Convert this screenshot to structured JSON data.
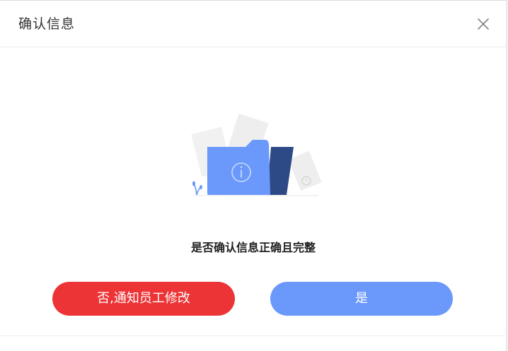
{
  "dialog": {
    "title": "确认信息",
    "message": "是否确认信息正确且完整",
    "illustration_icon": "folder-info-icon",
    "close_icon": "close-icon"
  },
  "buttons": {
    "no_label": "否,通知员工修改",
    "yes_label": "是"
  },
  "colors": {
    "no_button": "#ec3436",
    "yes_button": "#6a98fb",
    "folder_front": "#6a98fb",
    "folder_back": "#2e4a86"
  }
}
